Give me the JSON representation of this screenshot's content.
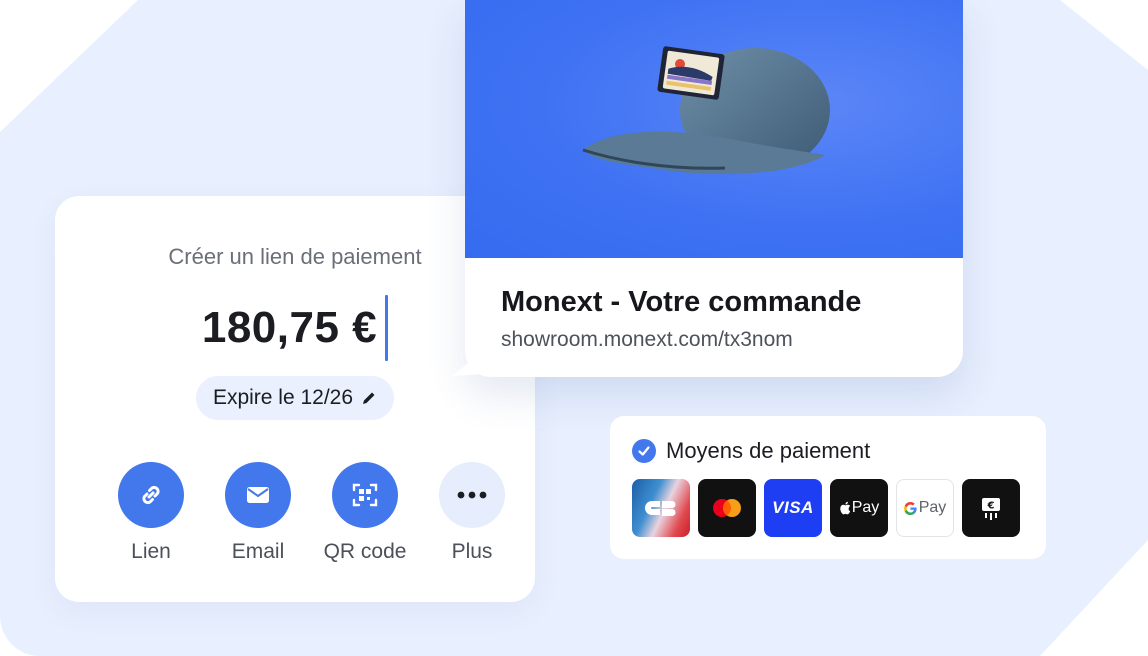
{
  "payment_link": {
    "title": "Créer un lien de paiement",
    "amount": "180,75 €",
    "expiry": "Expire le 12/26",
    "actions": [
      {
        "label": "Lien",
        "icon": "link-icon"
      },
      {
        "label": "Email",
        "icon": "envelope-icon"
      },
      {
        "label": "QR code",
        "icon": "qr-code-icon"
      },
      {
        "label": "Plus",
        "icon": "more-dots-icon"
      }
    ]
  },
  "product": {
    "title": "Monext - Votre commande",
    "url": "showroom.monext.com/tx3nom"
  },
  "payment_methods": {
    "label": "Moyens de paiement",
    "methods": [
      {
        "name": "CB",
        "icon": "cb-logo-icon"
      },
      {
        "name": "Mastercard",
        "icon": "mastercard-logo-icon"
      },
      {
        "name": "VISA",
        "icon": "visa-logo-icon"
      },
      {
        "name": "Pay",
        "icon": "apple-pay-logo-icon"
      },
      {
        "name": "Pay",
        "icon": "google-pay-logo-icon"
      },
      {
        "name": "Other",
        "icon": "euro-terminal-icon"
      }
    ]
  },
  "colors": {
    "accent": "#4377ec",
    "background": "#e8effe",
    "product_bg": "#3f72f3"
  }
}
